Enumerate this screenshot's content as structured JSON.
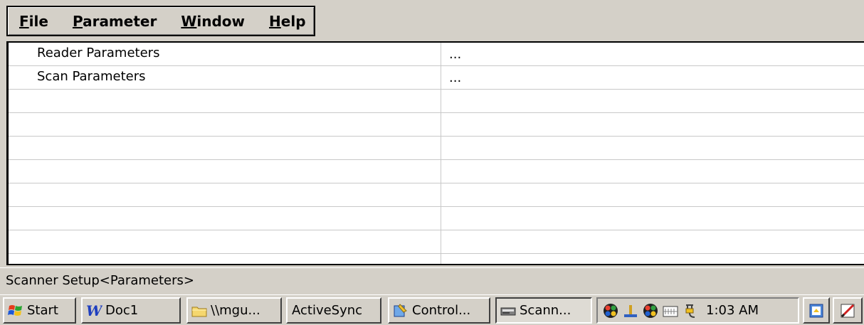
{
  "menu": {
    "items": [
      {
        "accel": "F",
        "rest": "ile"
      },
      {
        "accel": "P",
        "rest": "arameter"
      },
      {
        "accel": "W",
        "rest": "indow"
      },
      {
        "accel": "H",
        "rest": "elp"
      }
    ]
  },
  "grid": {
    "rows": [
      {
        "name": "Reader Parameters",
        "value": "..."
      },
      {
        "name": "Scan Parameters",
        "value": "..."
      },
      {
        "name": "",
        "value": ""
      },
      {
        "name": "",
        "value": ""
      },
      {
        "name": "",
        "value": ""
      },
      {
        "name": "",
        "value": ""
      },
      {
        "name": "",
        "value": ""
      },
      {
        "name": "",
        "value": ""
      },
      {
        "name": "",
        "value": ""
      },
      {
        "name": "",
        "value": ""
      }
    ]
  },
  "status": {
    "text": "Scanner Setup<Parameters>"
  },
  "taskbar": {
    "start_label": "Start",
    "buttons": [
      {
        "label": "Doc1",
        "icon": "word-icon"
      },
      {
        "label": "\\\\mgu...",
        "icon": "folder-icon"
      },
      {
        "label": "ActiveSync",
        "icon": ""
      },
      {
        "label": "Control...",
        "icon": "control-panel-icon"
      },
      {
        "label": "Scann...",
        "icon": "scanner-icon"
      }
    ],
    "clock": "1:03 AM",
    "tray_icons": [
      "network-icon",
      "connection-icon",
      "network-icon",
      "keyboard-icon",
      "power-icon"
    ]
  },
  "colors": {
    "chrome": "#d4d0c8",
    "grid_line": "#c8c8c8"
  }
}
